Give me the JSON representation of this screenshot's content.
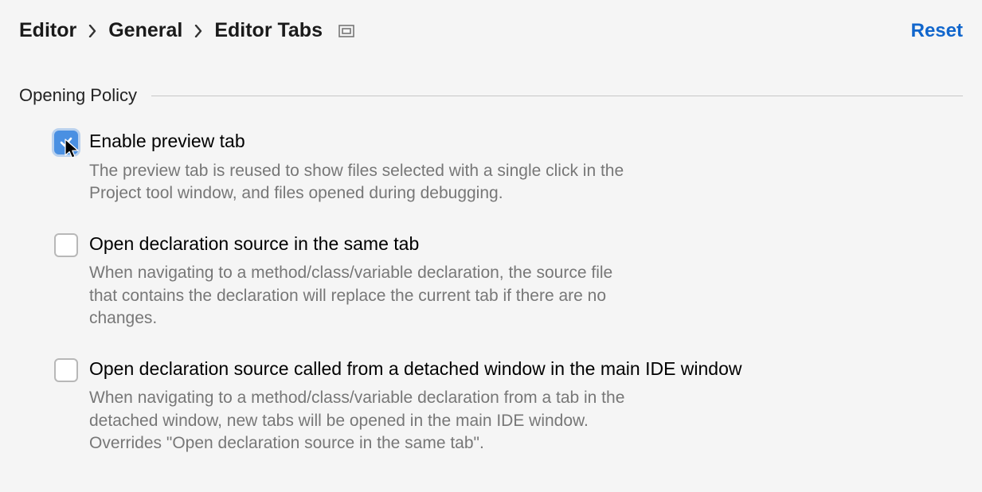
{
  "breadcrumb": {
    "item0": "Editor",
    "item1": "General",
    "item2": "Editor Tabs"
  },
  "header": {
    "reset": "Reset"
  },
  "section": {
    "title": "Opening Policy"
  },
  "options": [
    {
      "checked": true,
      "label": "Enable preview tab",
      "desc": "The preview tab is reused to show files selected with a single click in the Project tool window, and files opened during debugging."
    },
    {
      "checked": false,
      "label": "Open declaration source in the same tab",
      "desc": "When navigating to a method/class/variable declaration, the source file that contains the declaration will replace the current tab if there are no changes."
    },
    {
      "checked": false,
      "label": "Open declaration source called from a detached window in the main IDE window",
      "desc": "When navigating to a method/class/variable declaration from a tab in the detached window, new tabs will be opened in the main IDE window. Overrides \"Open declaration source in the same tab\"."
    }
  ]
}
